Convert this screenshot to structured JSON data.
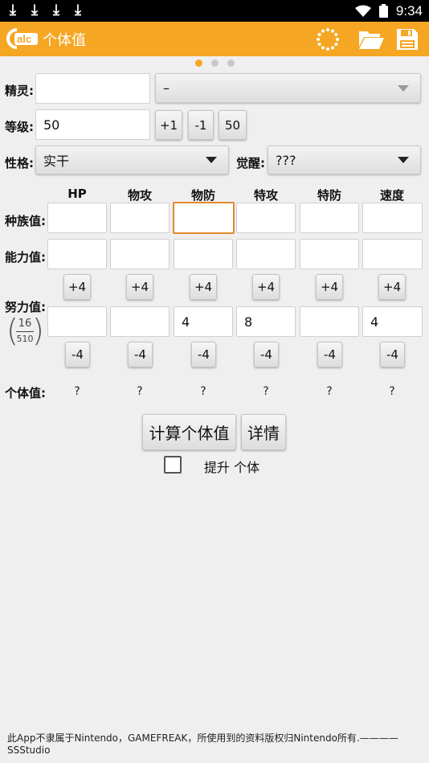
{
  "status_bar": {
    "time": "9:34",
    "download_glyph": "⤓"
  },
  "app_bar": {
    "logo_text": "alc",
    "title": "个体值",
    "icons": [
      "loading-spinner-icon",
      "folder-open-icon",
      "save-icon"
    ]
  },
  "pager": {
    "pages": 3,
    "active": 0
  },
  "form": {
    "pokemon_label": "精灵:",
    "pokemon_value": "",
    "pokemon_dropdown_value": "–",
    "level_label": "等级:",
    "level_value": "50",
    "level_buttons": [
      "+1",
      "-1",
      "50"
    ],
    "nature_label": "性格:",
    "nature_value": "实干",
    "awaken_label": "觉醒:",
    "awaken_value": "???"
  },
  "stats": {
    "headers": [
      "HP",
      "物攻",
      "物防",
      "特攻",
      "特防",
      "速度"
    ],
    "base_label": "种族值:",
    "base_values": [
      "",
      "",
      "",
      "",
      "",
      ""
    ],
    "ability_label": "能力值:",
    "ability_values": [
      "",
      "",
      "",
      "",
      "",
      ""
    ],
    "ev_label": "努力值:",
    "ev_values": [
      "",
      "",
      "4",
      "8",
      "",
      "4"
    ],
    "ev_fraction": {
      "used": "16",
      "total": "510"
    },
    "plus_label": "+4",
    "minus_label": "-4",
    "iv_label": "个体值:",
    "iv_values": [
      "?",
      "?",
      "?",
      "?",
      "?",
      "?"
    ]
  },
  "actions": {
    "calc_label": "计算个体值",
    "detail_label": "详情",
    "raise_label": "提升 个体",
    "raise_checked": false
  },
  "footer": {
    "text": "此App不隶属于Nintendo，GAMEFREAK，所使用到的资料版权归Nintendo所有.————SSStudio"
  },
  "colors": {
    "accent": "#f5a623",
    "focus": "#e08a2c"
  }
}
